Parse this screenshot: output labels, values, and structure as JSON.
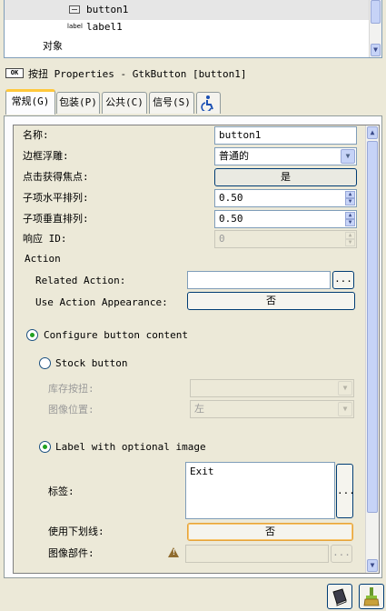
{
  "tree": {
    "items": [
      {
        "label": "button1",
        "icon": "button-widget-icon"
      },
      {
        "label": "label1",
        "icon_text": "label"
      },
      {
        "label": "对象"
      }
    ]
  },
  "heading": {
    "icon_text": "OK",
    "text": "按扭 Properties - GtkButton [button1]"
  },
  "tabs": [
    {
      "label": "常规(G)",
      "active": true
    },
    {
      "label": "包装(P)"
    },
    {
      "label": "公共(C)"
    },
    {
      "label": "信号(S)"
    },
    {
      "label": "",
      "icon": "accessibility-icon"
    }
  ],
  "props": {
    "name_label": "名称:",
    "name_value": "button1",
    "relief_label": "边框浮雕:",
    "relief_value": "普通的",
    "focus_label": "点击获得焦点:",
    "focus_value": "是",
    "xalign_label": "子项水平排列:",
    "xalign_value": "0.50",
    "yalign_label": "子项垂直排列:",
    "yalign_value": "0.50",
    "response_label": "响应 ID:",
    "response_value": "0",
    "action_heading": "Action",
    "related_action_label": "Related Action:",
    "related_action_value": "",
    "related_action_button": "...",
    "use_action_label": "Use Action Appearance:",
    "use_action_value": "否",
    "configure_label": "Configure button content",
    "stock_label": "Stock button",
    "stock_button_label": "库存按扭:",
    "stock_button_value": "",
    "image_pos_label": "图像位置:",
    "image_pos_value": "左",
    "label_image_label": "Label with optional image",
    "text_label": "标签:",
    "text_value": "Exit",
    "text_edit_button": "...",
    "underline_label": "使用下划线:",
    "underline_value": "否",
    "image_widget_label": "图像部件:",
    "image_widget_value": "",
    "image_widget_button": "..."
  }
}
